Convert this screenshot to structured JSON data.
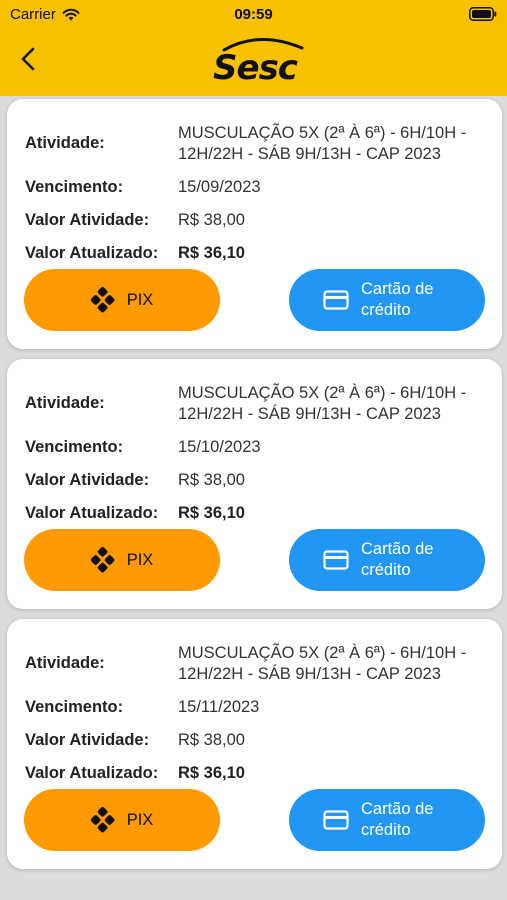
{
  "status_bar": {
    "carrier": "Carrier",
    "time": "09:59"
  },
  "header": {
    "back_icon": "chevron-left-icon",
    "logo_text": "Sesc",
    "background": "#f7c100"
  },
  "labels": {
    "activity": "Atividade:",
    "due_date": "Vencimento:",
    "activity_value": "Valor Atividade:",
    "updated_value": "Valor Atualizado:"
  },
  "buttons": {
    "pix_label": "PIX",
    "pix_icon": "pix-icon",
    "card_label": "Cartão de crédito",
    "card_icon": "credit-card-icon",
    "pix_color": "#ff9a00",
    "card_color": "#2196f3"
  },
  "payments": [
    {
      "activity": "MUSCULAÇÃO 5X (2ª À 6ª) - 6H/10H - 12H/22H - SÁB 9H/13H - CAP 2023",
      "due_date": "15/09/2023",
      "activity_value": "R$  38,00",
      "updated_value": "R$  36,10"
    },
    {
      "activity": "MUSCULAÇÃO 5X (2ª À 6ª) - 6H/10H - 12H/22H - SÁB 9H/13H - CAP 2023",
      "due_date": "15/10/2023",
      "activity_value": "R$  38,00",
      "updated_value": "R$  36,10"
    },
    {
      "activity": "MUSCULAÇÃO 5X (2ª À 6ª) - 6H/10H - 12H/22H - SÁB 9H/13H - CAP 2023",
      "due_date": "15/11/2023",
      "activity_value": "R$  38,00",
      "updated_value": "R$  36,10"
    }
  ]
}
